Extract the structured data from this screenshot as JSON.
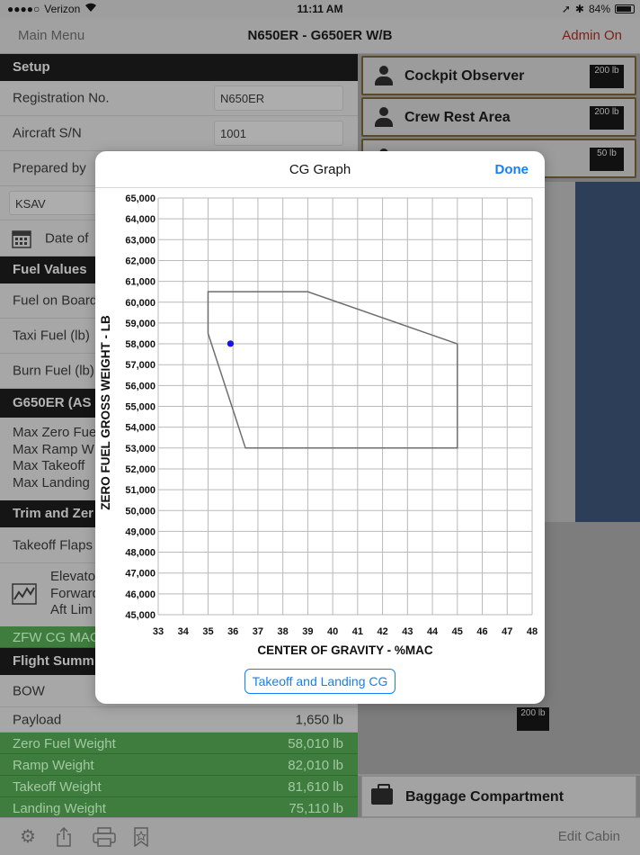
{
  "status_bar": {
    "carrier": "Verizon",
    "time": "11:11 AM",
    "battery": "84%"
  },
  "nav": {
    "back_label": "Main Menu",
    "title": "N650ER - G650ER W/B",
    "admin_label": "Admin On"
  },
  "setup": {
    "header": "Setup",
    "registration_label": "Registration No.",
    "registration_value": "N650ER",
    "serial_label": "Aircraft S/N",
    "serial_value": "1001",
    "prepared_label": "Prepared by",
    "airport_value": "KSAV",
    "date_label": "Date of"
  },
  "fuel": {
    "header": "Fuel Values",
    "fuel_on_board": "Fuel on Board",
    "taxi_fuel": "Taxi Fuel (lb)",
    "burn_fuel": "Burn Fuel (lb)"
  },
  "limits": {
    "header": "G650ER (AS",
    "lines": [
      "Max Zero Fue",
      "Max Ramp W",
      "Max Takeoff",
      "Max Landing"
    ]
  },
  "trim": {
    "header": "Trim and Zer",
    "flaps_label": "Takeoff Flaps",
    "elevator_lines": [
      "Elevato",
      "Forward",
      "Aft Lim"
    ],
    "zfw_cg_label": "ZFW CG MAC"
  },
  "summary": {
    "header": "Flight Summ",
    "bow_label": "BOW",
    "payload_label": "Payload",
    "payload_value": "1,650 lb",
    "zfw_label": "Zero Fuel Weight",
    "zfw_value": "58,010 lb",
    "ramp_label": "Ramp Weight",
    "ramp_value": "82,010 lb",
    "takeoff_label": "Takeoff Weight",
    "takeoff_value": "81,610 lb",
    "landing_label": "Landing Weight",
    "landing_value": "75,110 lb"
  },
  "cabin": {
    "cockpit_observer": "Cockpit Observer",
    "cockpit_observer_weight": "200 lb",
    "crew_rest": "Crew Rest Area",
    "crew_rest_weight": "200 lb",
    "third_seat_weight": "50 lb",
    "seat_weight": "200 lb",
    "baggage": "Baggage Compartment"
  },
  "toolbar": {
    "edit_cabin_label": "Edit Cabin"
  },
  "modal": {
    "title": "CG Graph",
    "done_label": "Done",
    "button_label": "Takeoff and Landing CG"
  },
  "chart_data": {
    "type": "scatter",
    "xlabel": "CENTER OF GRAVITY - %MAC",
    "ylabel": "ZERO FUEL GROSS WEIGHT - LB",
    "xlim": [
      33,
      48
    ],
    "ylim": [
      45000,
      65000
    ],
    "x_ticks": [
      33,
      34,
      35,
      36,
      37,
      38,
      39,
      40,
      41,
      42,
      43,
      44,
      45,
      46,
      47,
      48
    ],
    "y_ticks": [
      45000,
      46000,
      47000,
      48000,
      49000,
      50000,
      51000,
      52000,
      53000,
      54000,
      55000,
      56000,
      57000,
      58000,
      59000,
      60000,
      61000,
      62000,
      63000,
      64000,
      65000
    ],
    "y_tick_labels": [
      "45,000",
      "46,000",
      "47,000",
      "48,000",
      "49,000",
      "50,000",
      "51,000",
      "52,000",
      "53,000",
      "54,000",
      "55,000",
      "56,000",
      "57,000",
      "58,000",
      "59,000",
      "60,000",
      "61,000",
      "62,000",
      "63,000",
      "64,000",
      "65,000"
    ],
    "grid": true,
    "envelope": [
      {
        "x": 35.0,
        "y": 60500
      },
      {
        "x": 39.0,
        "y": 60500
      },
      {
        "x": 45.0,
        "y": 58000
      },
      {
        "x": 45.0,
        "y": 53000
      },
      {
        "x": 36.5,
        "y": 53000
      },
      {
        "x": 35.0,
        "y": 58500
      }
    ],
    "envelope_color": "#6e6e6e",
    "points": [
      {
        "x": 35.9,
        "y": 58010
      }
    ],
    "point_color": "#1515e6"
  }
}
